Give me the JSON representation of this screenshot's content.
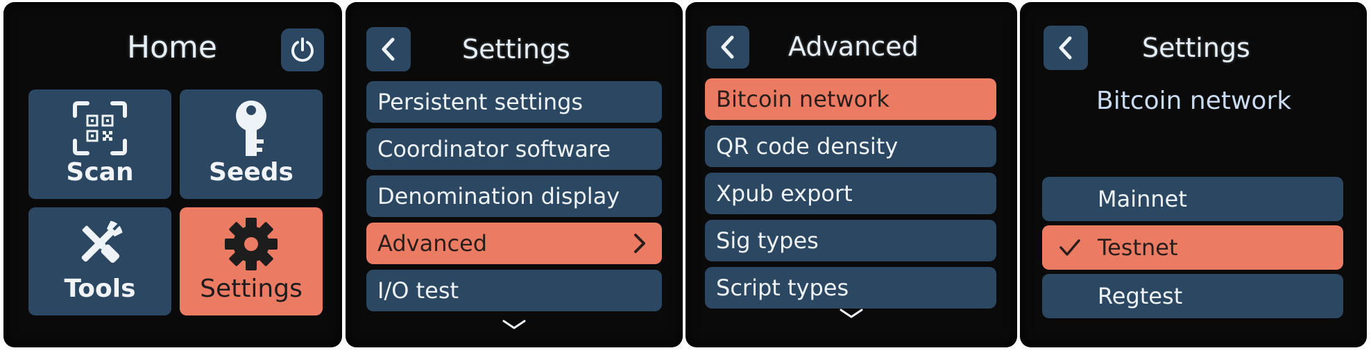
{
  "screen1": {
    "title": "Home",
    "power_icon": "power-icon",
    "tiles": [
      {
        "label": "Scan",
        "icon": "qr-scan-icon"
      },
      {
        "label": "Seeds",
        "icon": "key-icon"
      },
      {
        "label": "Tools",
        "icon": "tools-icon"
      },
      {
        "label": "Settings",
        "icon": "gear-icon",
        "active": true
      }
    ]
  },
  "screen2": {
    "title": "Settings",
    "items": [
      {
        "label": "Persistent settings"
      },
      {
        "label": "Coordinator software"
      },
      {
        "label": "Denomination display"
      },
      {
        "label": "Advanced",
        "active": true
      },
      {
        "label": "I/O test"
      }
    ]
  },
  "screen3": {
    "title": "Advanced",
    "items": [
      {
        "label": "Bitcoin network",
        "active": true
      },
      {
        "label": "QR code density"
      },
      {
        "label": "Xpub export"
      },
      {
        "label": "Sig types"
      },
      {
        "label": "Script types"
      }
    ]
  },
  "screen4": {
    "title": "Settings",
    "subtitle": "Bitcoin network",
    "options": [
      {
        "label": "Mainnet"
      },
      {
        "label": "Testnet",
        "selected": true
      },
      {
        "label": "Regtest"
      }
    ]
  },
  "colors": {
    "button_bg": "#2b4761",
    "accent": "#ec7b64",
    "screen_bg": "#0a0a0a"
  }
}
